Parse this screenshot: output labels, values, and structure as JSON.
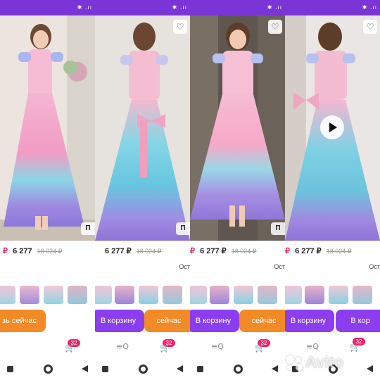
{
  "screenshots": [
    {
      "id": "s1",
      "price": "6 277",
      "old_price": "18 024 ₽",
      "rest": "",
      "buy_label": "зь сейчас",
      "cart_count": "32",
      "variant": "front"
    },
    {
      "id": "s2",
      "price": "6 277 ₽",
      "old_price": "18 024 ₽",
      "rest": "Ост",
      "buy_label": "В корзину",
      "buy2_label": "сейчас",
      "cart_count": "32",
      "variant": "back"
    },
    {
      "id": "s3",
      "price": "6 277 ₽",
      "old_price": "18 024 ₽",
      "rest": "Ост",
      "buy_label": "В корзину",
      "buy2_label": "сейчас",
      "cart_count": "32",
      "variant": "front2"
    },
    {
      "id": "s4",
      "price": "6 277 ₽",
      "old_price": "18 024 ₽",
      "rest": "Ост",
      "buy_label": "В корзину",
      "buy2_label": "сейчас",
      "cart_count": "32",
      "variant": "back2"
    },
    {
      "id": "s5",
      "price": "6 277",
      "old_price": "",
      "rest": "Ост",
      "buy_label": "В кор",
      "cart_count": "32",
      "variant": "none"
    }
  ],
  "common": {
    "currency_glyph": "₽",
    "tag_label": "П",
    "status_icons": "✱ .ıı",
    "fav_icon": "heart-outline-icon",
    "watermark": "Avito"
  },
  "colors": {
    "status_bar": "#7b35d6",
    "buy_violet": "#8b3df0",
    "buy_orange": "#f28a25",
    "badge": "#f0246a",
    "price_ruble": "#e2236b"
  }
}
